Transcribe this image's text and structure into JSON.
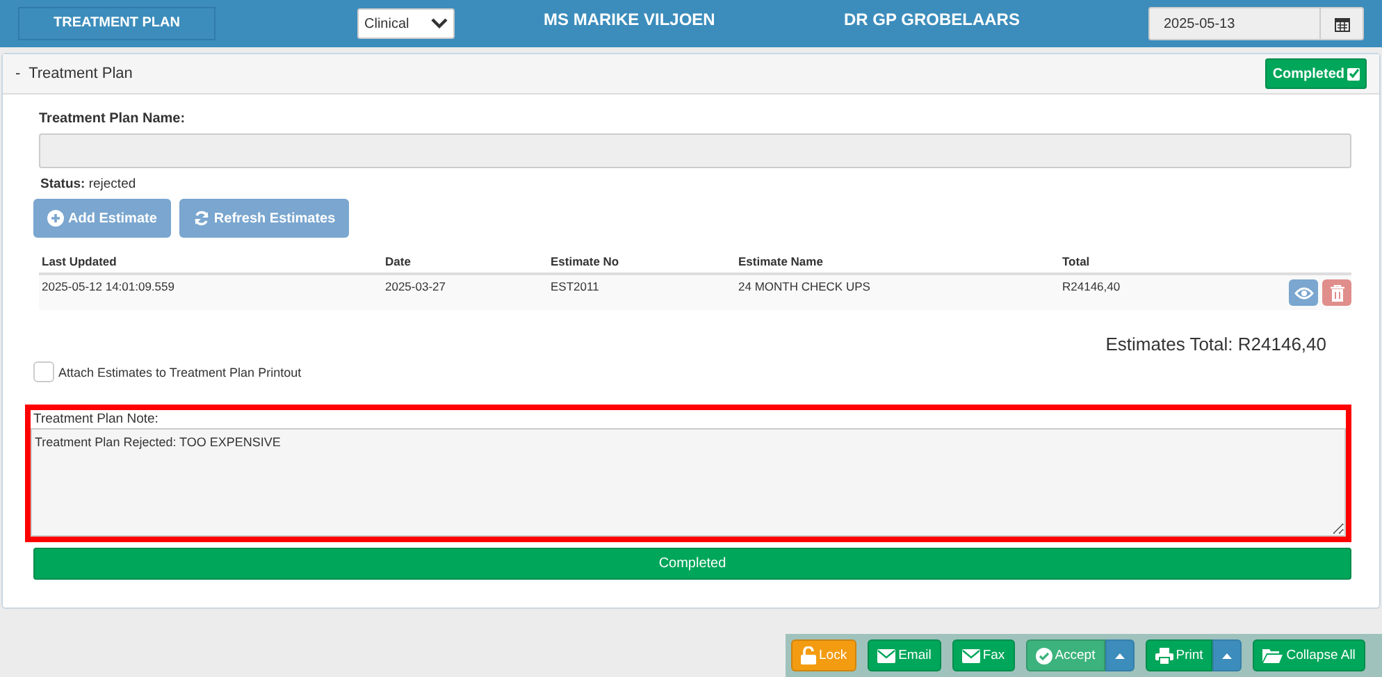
{
  "header": {
    "tab": "TREATMENT PLAN",
    "select": "Clinical",
    "patient": "MS MARIKE VILJOEN",
    "doctor": "DR GP GROBELAARS",
    "date": "2025-05-13"
  },
  "panel": {
    "toggle": "-",
    "title": "Treatment Plan",
    "badge": "Completed",
    "badge_checked": true
  },
  "form": {
    "name_label": "Treatment Plan Name:",
    "status_label": "Status:",
    "status": "rejected"
  },
  "actions": [
    {
      "kind": "add",
      "label": "Add Estimate",
      "disabled": true
    },
    {
      "kind": "refresh",
      "label": "Refresh Estimates",
      "disabled": true
    }
  ],
  "table": {
    "columns": [
      "Last Updated",
      "Date",
      "Estimate No",
      "Estimate Name",
      "Total"
    ],
    "rows": [
      {
        "cells": [
          "2025-05-12 14:01:09.559",
          "2025-03-27",
          "EST2011",
          "24 MONTH CHECK UPS",
          "R24146,40"
        ]
      }
    ]
  },
  "estimates_total": "Estimates Total: R24146,40",
  "attach": {
    "label": "Attach Estimates to Treatment Plan Printout",
    "checked": false
  },
  "note": {
    "label": "Treatment Plan Note:",
    "value": "Treatment Plan Rejected: TOO EXPENSIVE",
    "highlighted": true
  },
  "completed_button": "Completed",
  "toolbar": [
    {
      "kind": "lock",
      "label": "Lock",
      "color": "#f39c12",
      "dropdown": false
    },
    {
      "kind": "mail",
      "label": "Email",
      "color": "#00a65a",
      "dropdown": false
    },
    {
      "kind": "mail",
      "label": "Fax",
      "color": "#00a65a",
      "dropdown": false
    },
    {
      "kind": "check",
      "label": "Accept",
      "color": "#3cb37c",
      "dropdown": true
    },
    {
      "kind": "print",
      "label": "Print",
      "color": "#00a65a",
      "dropdown": true
    },
    {
      "kind": "folder",
      "label": "Collapse All",
      "color": "#00a65a",
      "dropdown": false
    }
  ]
}
